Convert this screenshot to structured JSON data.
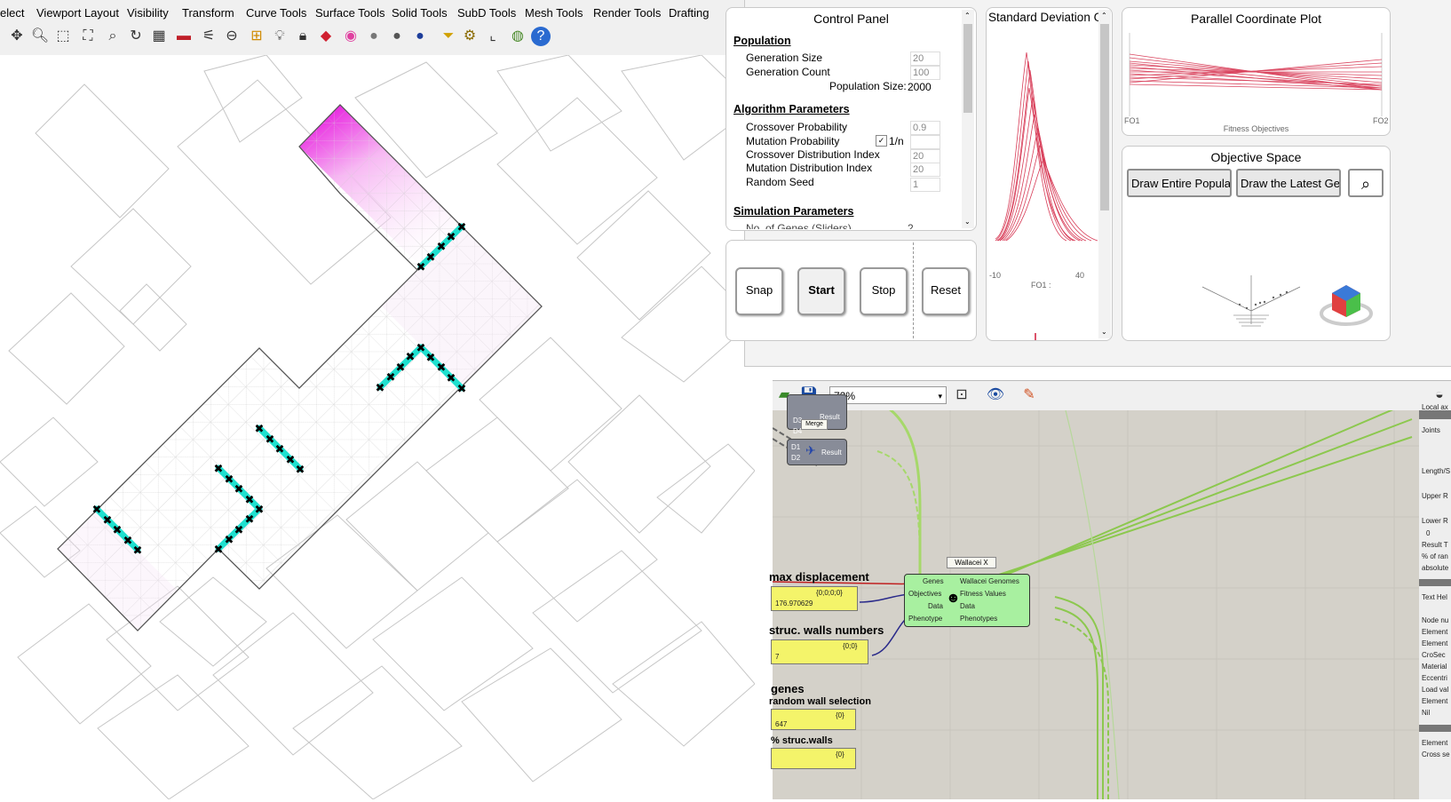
{
  "menu": [
    "elect",
    "Viewport Layout",
    "Visibility",
    "Transform",
    "Curve Tools",
    "Surface Tools",
    "Solid Tools",
    "SubD Tools",
    "Mesh Tools",
    "Render Tools",
    "Drafting"
  ],
  "toolbar_icons": [
    "pan-icon",
    "zoom-icon",
    "zoom-window-icon",
    "zoom-extents-icon",
    "zoom-selected-icon",
    "rotate-view-icon",
    "four-viewports-icon",
    "car-icon",
    "named-views-icon",
    "target-icon",
    "grid-snap-icon",
    "light-icon",
    "lock-icon",
    "layer-icon",
    "color-wheel-icon",
    "shaded-sphere-icon",
    "rendered-sphere-icon",
    "blue-sphere-icon",
    "filter-icon",
    "settings-icon",
    "dimension-icon",
    "globe-icon",
    "help-icon"
  ],
  "control_panel": {
    "title": "Control Panel",
    "population_heading": "Population",
    "generation_size_label": "Generation Size",
    "generation_size": "20",
    "generation_count_label": "Generation Count",
    "generation_count": "100",
    "population_size_label": "Population Size:",
    "population_size": "2000",
    "algorithm_heading": "Algorithm Parameters",
    "crossover_prob_label": "Crossover Probability",
    "crossover_prob": "0.9",
    "mutation_prob_label": "Mutation Probability",
    "mutation_checkbox_label": "1/n",
    "crossover_dist_label": "Crossover Distribution Index",
    "crossover_dist": "20",
    "mutation_dist_label": "Mutation Distribution Index",
    "mutation_dist": "20",
    "random_seed_label": "Random Seed",
    "random_seed": "1",
    "simulation_heading": "Simulation Parameters",
    "genes_label": "No. of Genes (Sliders)",
    "genes_value": "2"
  },
  "buttons": {
    "snap": "Snap",
    "start": "Start",
    "stop": "Stop",
    "reset": "Reset"
  },
  "std_chart": {
    "title": "Standard Deviation G",
    "x_min": "-10",
    "x_max": "40",
    "x_label": "FO1 :"
  },
  "pcp": {
    "title": "Parallel Coordinate Plot",
    "left_label": "FO1",
    "right_label": "FO2",
    "axis_label": "Fitness Objectives"
  },
  "objective_space": {
    "title": "Objective Space",
    "draw_entire": "Draw Entire Populatic",
    "draw_latest": "Draw the Latest Gene"
  },
  "gh": {
    "zoom": "72%",
    "merge_inputs": [
      "D3",
      "D4"
    ],
    "merge_output": "Result",
    "merge_label": "Merge",
    "merge2_inputs": [
      "D1",
      "D2"
    ],
    "merge2_output": "Result",
    "wallacei_label": "Wallacei X",
    "wallacei_inputs": [
      "Genes",
      "Objectives",
      "Data",
      "Phenotype"
    ],
    "wallacei_outputs": [
      "Wallacei Genomes",
      "Fitness Values",
      "Data",
      "Phenotypes"
    ],
    "max_disp_label": "max displacement",
    "max_disp_value": "176.970629",
    "max_disp_path": "{0;0;0;0}",
    "walls_label": "struc. walls numbers",
    "walls_value": "7",
    "walls_path": "{0;0}",
    "genes_label": "genes",
    "random_wall_label": "random wall selection",
    "random_wall_value": "647",
    "random_wall_path": "{0}",
    "pct_walls_label": "% struc.walls",
    "pct_walls_path": "{0}",
    "right_panel": [
      "Local ax",
      "Joints",
      "Length/S",
      "Upper R",
      "Lower R",
      "0",
      "Result T",
      "% of ran",
      "absolute",
      "Text Hel",
      "Node nu",
      "Element",
      "Element",
      "CroSec",
      "Material",
      "Eccentri",
      "Load val",
      "Element",
      "Nil",
      "Element",
      "Cross se"
    ]
  }
}
